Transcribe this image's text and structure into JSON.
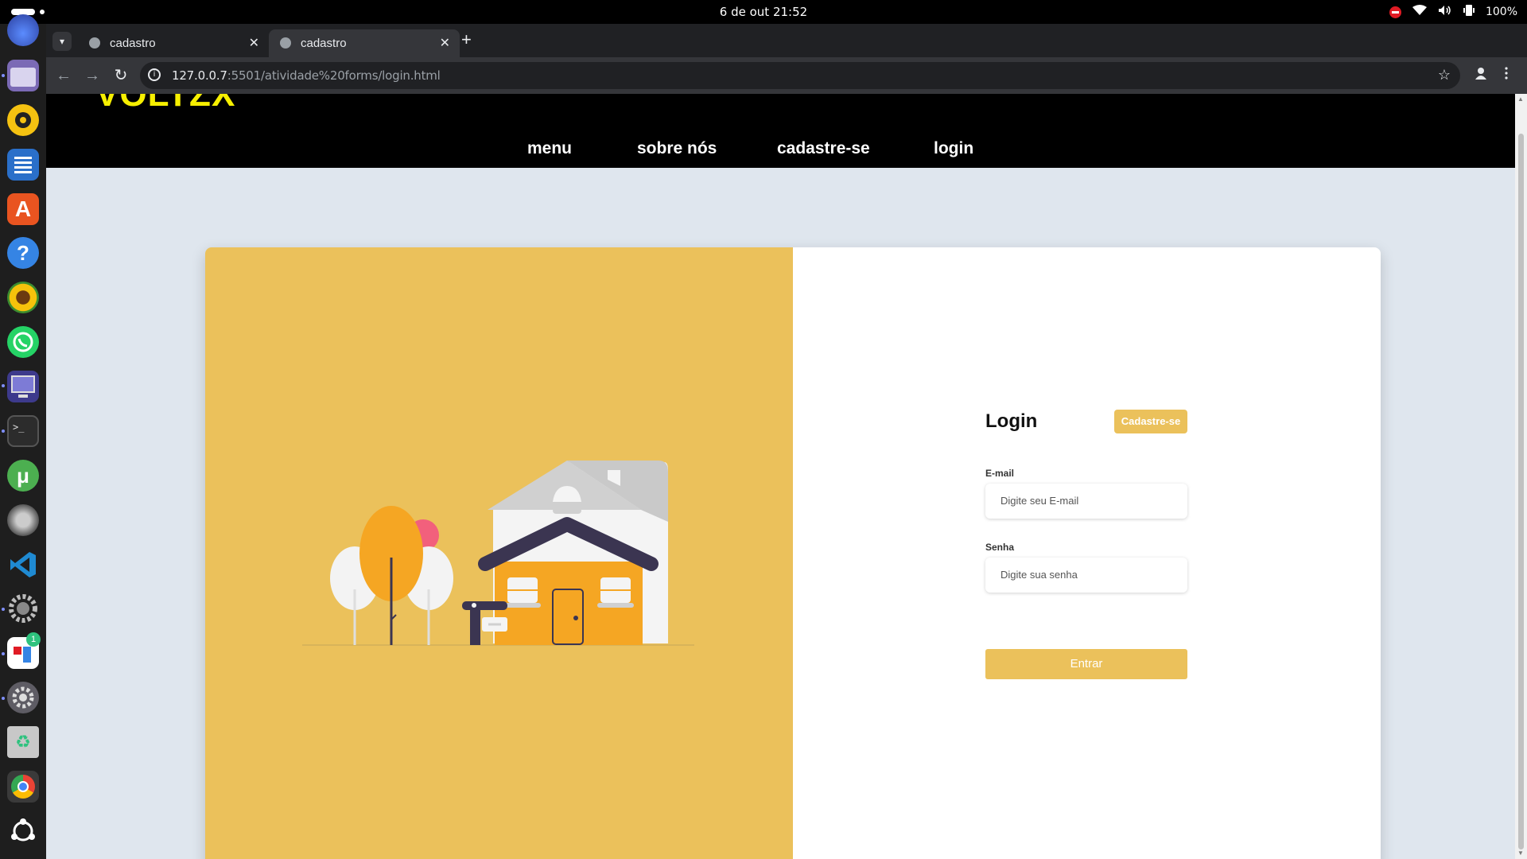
{
  "system_bar": {
    "clock": "6 de out  21:52",
    "battery": "100%"
  },
  "browser": {
    "tabs": [
      {
        "title": "cadastro",
        "active": false
      },
      {
        "title": "cadastro",
        "active": true
      }
    ],
    "new_tab": "+",
    "url_host": "127.0.0.7",
    "url_path": ":5501/atividade%20forms/login.html"
  },
  "site": {
    "logo": "VOLTZX",
    "nav": [
      "menu",
      "sobre nós",
      "cadastre-se",
      "login"
    ]
  },
  "login_form": {
    "title": "Login",
    "signup_button": "Cadastre-se",
    "email_label": "E-mail",
    "email_placeholder": "Digite seu E-mail",
    "password_label": "Senha",
    "password_placeholder": "Digite sua senha",
    "submit": "Entrar"
  },
  "colors": {
    "accent": "#ebc15b",
    "logo": "#f6ef00",
    "header_bg": "#000000",
    "page_bg": "#dfe6ee"
  },
  "dock_icons": [
    "firefox-icon",
    "files-icon",
    "rhythmbox-icon",
    "writer-icon",
    "app-center-icon",
    "help-icon",
    "sunflower-icon",
    "whatsapp-icon",
    "remote-desktop-icon",
    "terminal-icon",
    "utorrent-icon",
    "obs-icon",
    "vscode-icon",
    "settings-icon",
    "notification-app-icon",
    "system-settings-icon",
    "trash-icon",
    "chrome-icon",
    "ubuntu-icon"
  ]
}
